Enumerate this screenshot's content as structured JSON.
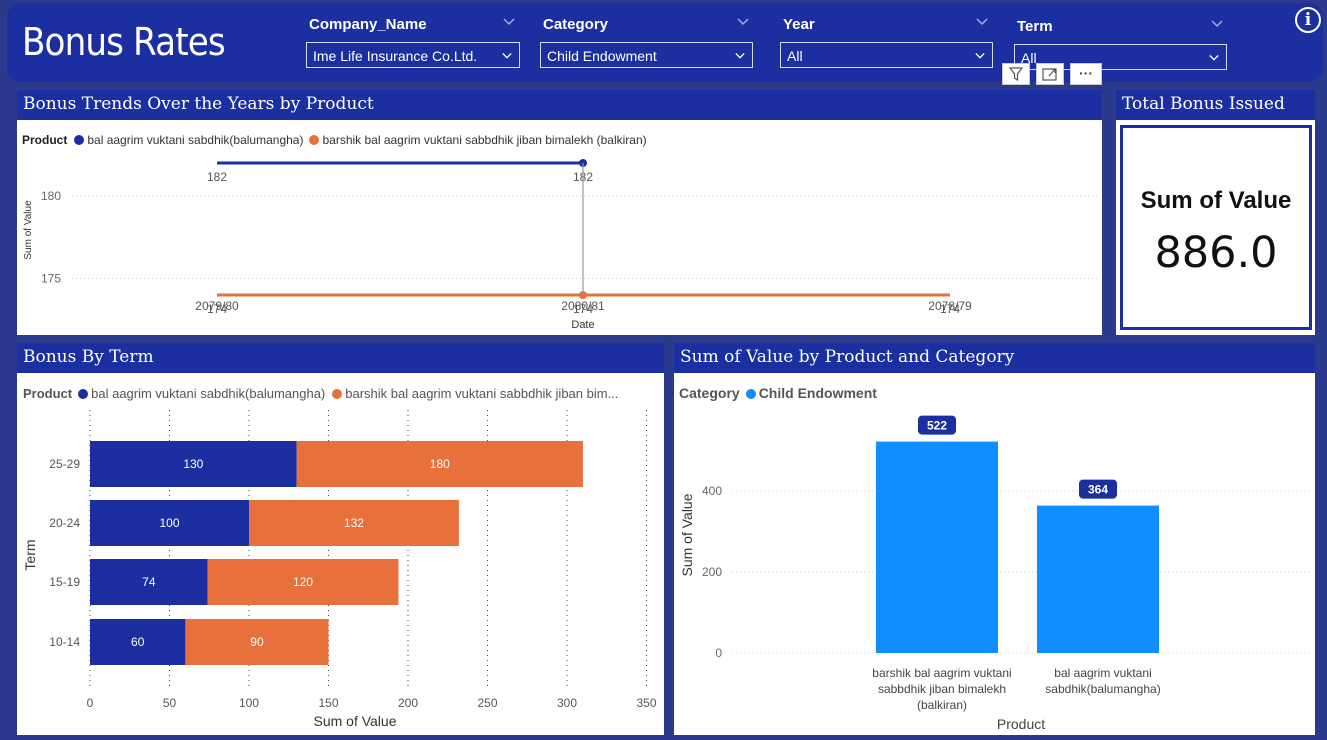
{
  "header": {
    "title": "Bonus Rates",
    "info_icon": "i",
    "slicers": [
      {
        "label": "Company_Name",
        "value": "Ime Life Insurance Co.Ltd."
      },
      {
        "label": "Category",
        "value": "Child Endowment"
      },
      {
        "label": "Year",
        "value": "All"
      },
      {
        "label": "Term",
        "value": "All"
      }
    ]
  },
  "toolbar": {
    "more_label": "···",
    "icons": [
      "filter-icon",
      "focus-mode-icon",
      "more-options-icon"
    ]
  },
  "colors": {
    "navy": "#1c2fa0",
    "orange": "#e8703a",
    "blue": "#118dff",
    "bg": "#2b3a8c"
  },
  "trend": {
    "title": "Bonus Trends Over the Years by Product",
    "legend_title": "Product",
    "series_names": [
      "bal aagrim vuktani sabdhik(balumangha)",
      "barshik bal aagrim vuktani sabbdhik jiban bimalekh (balkiran)"
    ],
    "ylabel": "Sum of Value",
    "xlabel": "Date"
  },
  "kpi": {
    "title": "Total Bonus Issued",
    "label": "Sum of Value",
    "value": "886.0"
  },
  "term_chart": {
    "title": "Bonus By Term",
    "legend_title": "Product",
    "series_names": [
      "bal aagrim vuktani sabdhik(balumangha)",
      "barshik bal aagrim vuktani sabbdhik jiban bim..."
    ],
    "ylabel": "Term",
    "xlabel": "Sum of Value"
  },
  "product_chart": {
    "title": "Sum of Value by Product and Category",
    "legend_title": "Category",
    "series_name": "Child Endowment",
    "ylabel": "Sum of Value",
    "xlabel": "Product"
  },
  "chart_data": [
    {
      "type": "line",
      "title": "Bonus Trends Over the Years by Product",
      "xlabel": "Date",
      "ylabel": "Sum of Value",
      "categories": [
        "2079/80",
        "2080/81",
        "2078/79"
      ],
      "yticks": [
        175,
        180
      ],
      "ylim": [
        173,
        183
      ],
      "grid": true,
      "series": [
        {
          "name": "bal aagrim vuktani sabdhik(balumangha)",
          "values": [
            182,
            182,
            null
          ],
          "labels": [
            "182",
            "182",
            ""
          ]
        },
        {
          "name": "barshik bal aagrim vuktani sabbdhik jiban bimalekh (balkiran)",
          "values": [
            174,
            174,
            174
          ],
          "labels": [
            "174",
            "174",
            "174"
          ]
        }
      ]
    },
    {
      "type": "bar",
      "orientation": "horizontal",
      "stacked": true,
      "title": "Bonus By Term",
      "xlabel": "Sum of Value",
      "ylabel": "Term",
      "categories": [
        "25-29",
        "20-24",
        "15-19",
        "10-14"
      ],
      "xticks": [
        0,
        50,
        100,
        150,
        200,
        250,
        300,
        350
      ],
      "xlim": [
        0,
        350
      ],
      "grid": true,
      "series": [
        {
          "name": "bal aagrim vuktani sabdhik(balumangha)",
          "values": [
            130,
            100,
            74,
            60
          ]
        },
        {
          "name": "barshik bal aagrim vuktani sabbdhik jiban bim...",
          "values": [
            180,
            132,
            120,
            90
          ]
        }
      ]
    },
    {
      "type": "bar",
      "title": "Sum of Value by Product and Category",
      "xlabel": "Product",
      "ylabel": "Sum of Value",
      "categories": [
        "barshik bal aagrim vuktani sabbdhik jiban bimalekh (balkiran)",
        "bal aagrim vuktani sabdhik(balumangha)"
      ],
      "category_lines": [
        [
          "barshik bal aagrim vuktani",
          "sabbdhik jiban bimalekh",
          "(balkiran)"
        ],
        [
          "bal aagrim vuktani",
          "sabdhik(balumangha)"
        ]
      ],
      "yticks": [
        0,
        200,
        400
      ],
      "ylim": [
        0,
        580
      ],
      "grid": true,
      "series": [
        {
          "name": "Child Endowment",
          "values": [
            522,
            364
          ]
        }
      ]
    }
  ]
}
